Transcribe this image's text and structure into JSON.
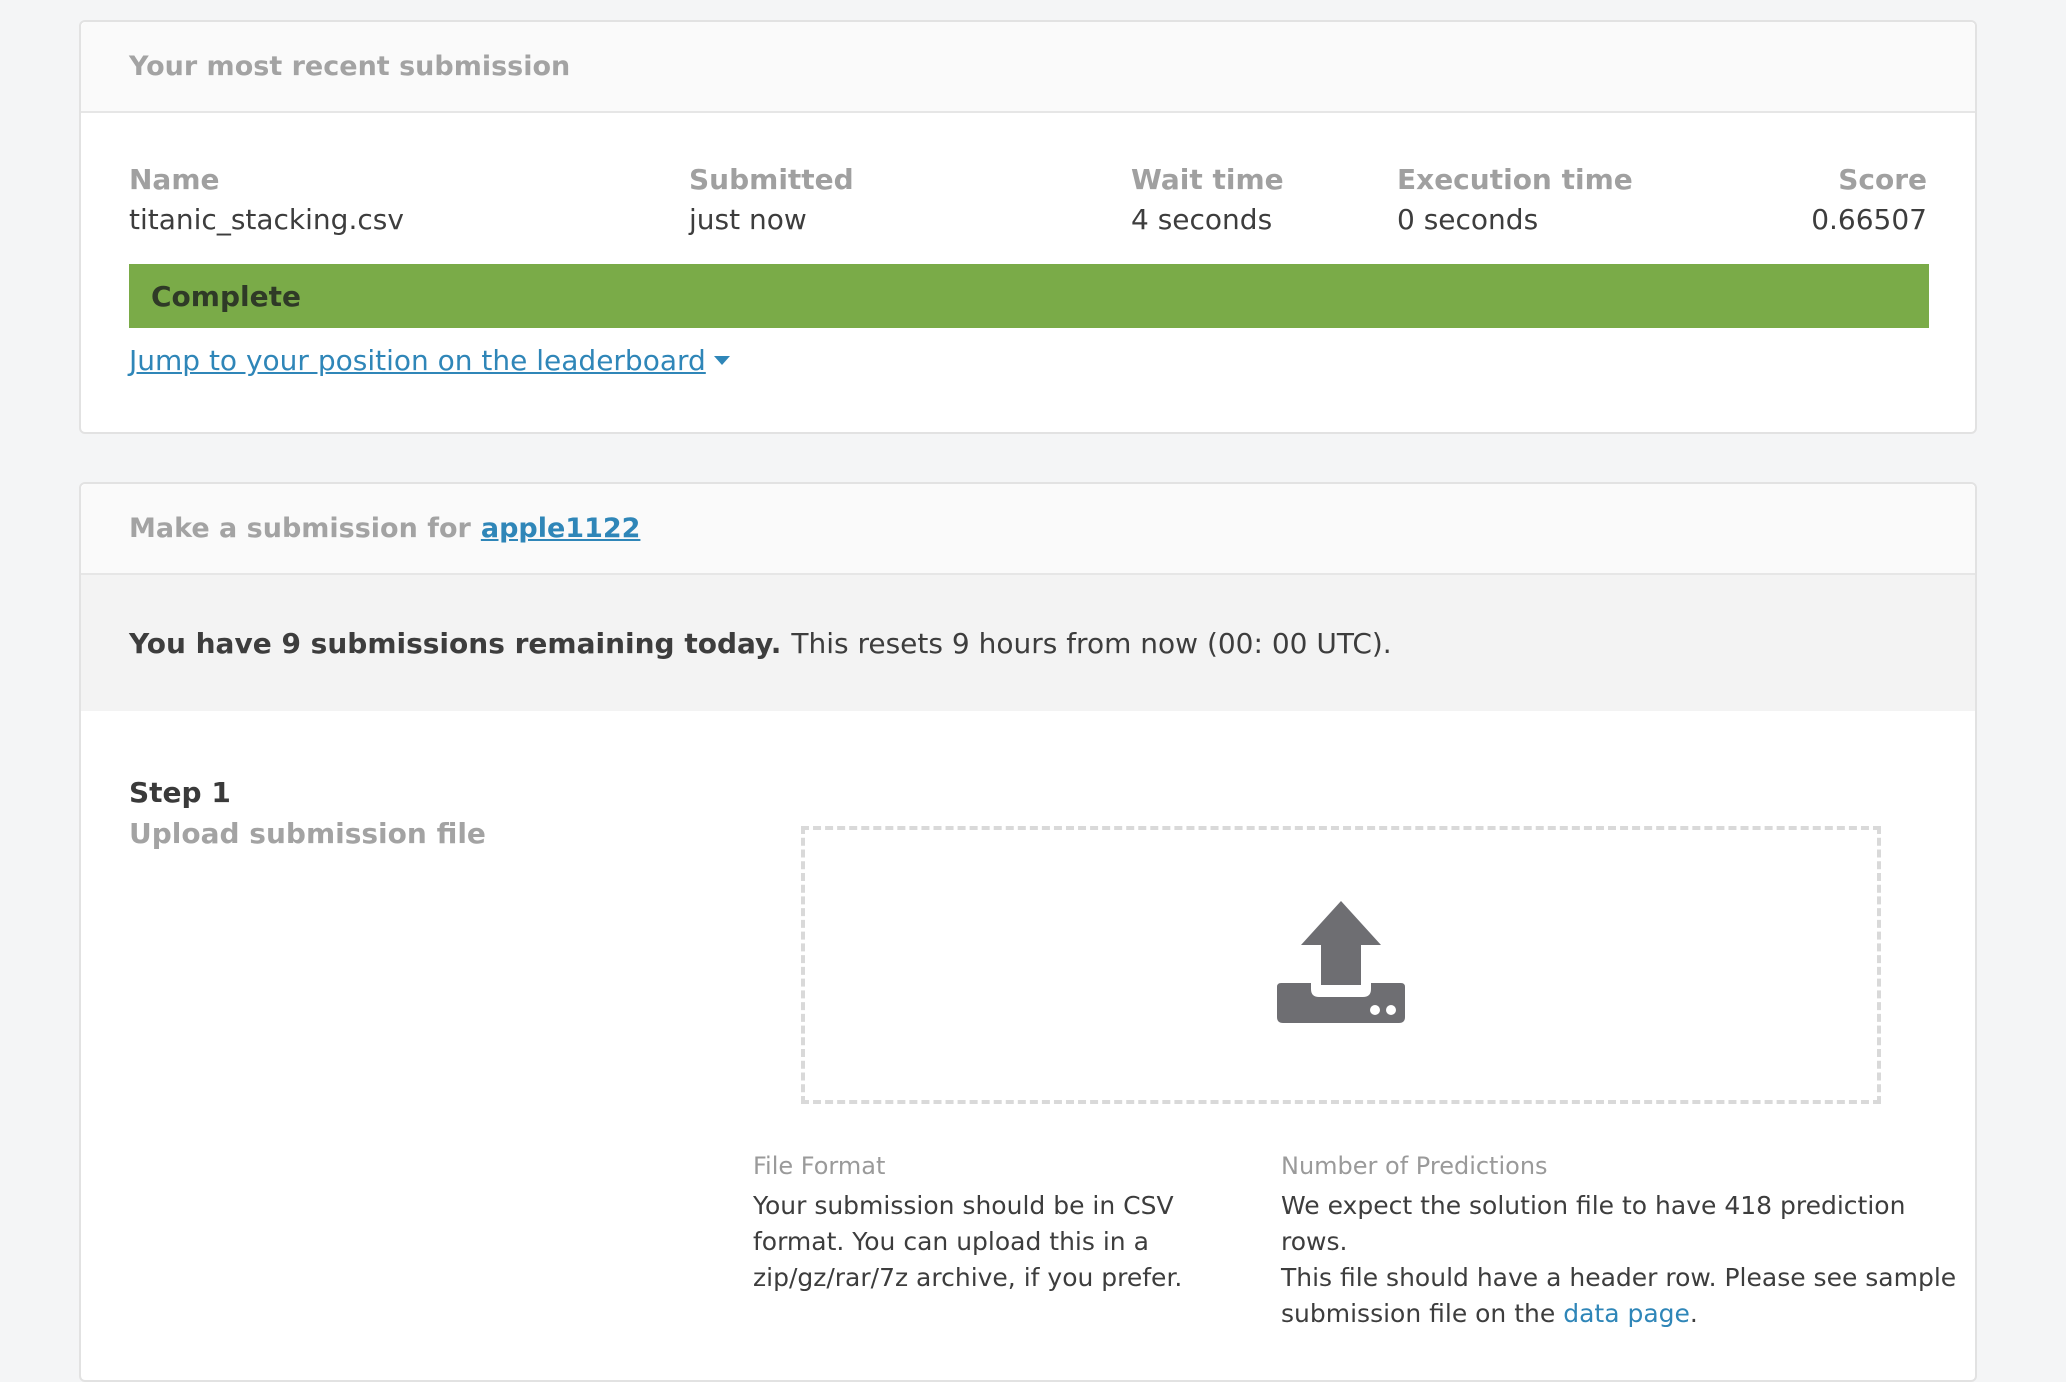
{
  "recent": {
    "header": "Your most recent submission",
    "columns": [
      {
        "label": "Name",
        "value": "titanic_stacking.csv"
      },
      {
        "label": "Submitted",
        "value": "just now"
      },
      {
        "label": "Wait time",
        "value": "4 seconds"
      },
      {
        "label": "Execution time",
        "value": "0 seconds"
      },
      {
        "label": "Score",
        "value": "0.66507"
      }
    ],
    "status": "Complete",
    "jump_link": "Jump to your position on the leaderboard"
  },
  "make": {
    "header_prefix": "Make a submission for",
    "team_link": "apple1122",
    "notice_bold": "You have 9 submissions remaining today.",
    "notice_rest": "This resets 9 hours from now (00: 00 UTC).",
    "step_title": "Step 1",
    "step_sub": "Upload submission file",
    "file_format": {
      "title": "File Format",
      "lines": [
        "Your submission should be in CSV",
        "format. You can upload this in a",
        "zip/gz/rar/7z archive, if you prefer."
      ]
    },
    "predictions": {
      "title": "Number of Predictions",
      "lines": [
        "We expect the solution file to have 418 prediction rows.",
        "This file should have a header row. Please see sample"
      ],
      "line3_prefix": "submission file on the",
      "link": "data page",
      "line3_suffix": "."
    }
  },
  "colors": {
    "accent": "#2f86b8",
    "complete": "#7aab48",
    "icon": "#6e6e72"
  },
  "icons": {
    "upload": "upload-icon",
    "caret": "caret-down-icon"
  }
}
